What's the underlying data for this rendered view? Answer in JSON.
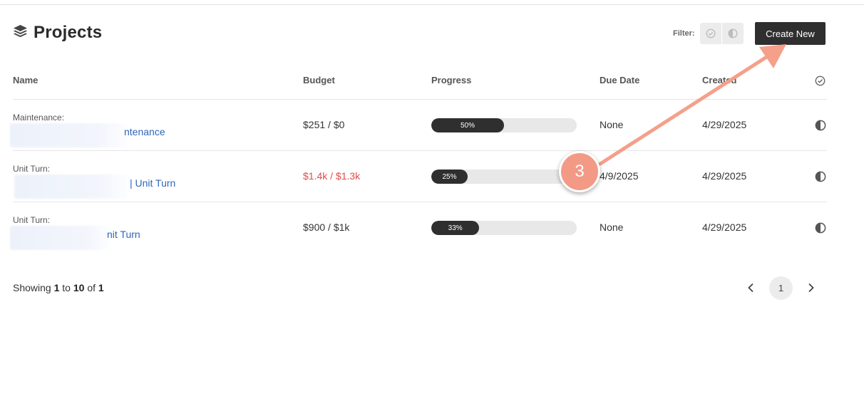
{
  "header": {
    "title": "Projects",
    "icon": "layers-icon",
    "filter_label": "Filter:",
    "filters": [
      {
        "name": "completed",
        "icon": "check-circle-icon"
      },
      {
        "name": "in-progress",
        "icon": "half-circle-icon"
      }
    ],
    "create_label": "Create New"
  },
  "table": {
    "columns": [
      "Name",
      "Budget",
      "Progress",
      "Due Date",
      "Created"
    ],
    "status_column_icon": "check-circle-icon",
    "rows": [
      {
        "type": "Maintenance:",
        "name_visible": "ntenance",
        "budget": "$251 / $0",
        "over_budget": false,
        "progress": 50,
        "progress_label": "50%",
        "due": "None",
        "created": "4/29/2025",
        "status_icon": "half-circle-icon"
      },
      {
        "type": "Unit Turn:",
        "name_visible": "| Unit Turn",
        "budget": "$1.4k / $1.3k",
        "over_budget": true,
        "progress": 25,
        "progress_label": "25%",
        "due": "4/9/2025",
        "created": "4/29/2025",
        "status_icon": "half-circle-icon"
      },
      {
        "type": "Unit Turn:",
        "name_visible": "nit Turn",
        "budget": "$900 / $1k",
        "over_budget": false,
        "progress": 33,
        "progress_label": "33%",
        "due": "None",
        "created": "4/29/2025",
        "status_icon": "half-circle-icon"
      }
    ]
  },
  "footer": {
    "showing_prefix": "Showing",
    "from": "1",
    "to_word": "to",
    "to": "10",
    "of_word": "of",
    "total": "1",
    "current_page": "1"
  },
  "annotation": {
    "step_number": "3",
    "color": "#f29a86"
  },
  "colors": {
    "primary_button": "#2f2f2f",
    "link": "#2e66b8",
    "over_budget": "#e04b4b",
    "progress_fill": "#2f2f2f",
    "progress_track": "#e8e8e8"
  }
}
